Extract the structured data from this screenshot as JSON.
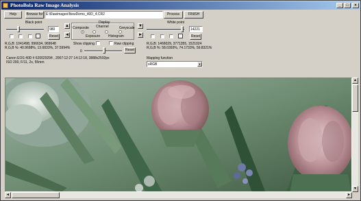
{
  "window": {
    "title": "PhotoBola Raw Image Analysis"
  },
  "toolbar": {
    "help": "Help",
    "browse": "Browse for",
    "file_path": "E:\\Rawimages\\NewDemo_40D_4.CR2",
    "process": "Process",
    "finish": "FINISH"
  },
  "black_point": {
    "title": "Black point",
    "value": "980",
    "reset": "Reset",
    "rgb": "R,G,B: 1041498, 996634, 969648",
    "rgb_pct": "R,G,B %: 40.9698%, 13.6833%, 37.5994%"
  },
  "white_point": {
    "title": "White point",
    "value": "14221",
    "reset": "Reset",
    "rgb": "R,G,B: 1466029, 3771355, 1521024",
    "rgb_pct": "R,G,B %: 58.0393%, 74.1733%, 59.8321%"
  },
  "display": {
    "title": "Display",
    "channel": "Channel",
    "composite": "Composite",
    "greyscale": "Greyscale",
    "exposure": "Exposure",
    "histogram": "Histogram",
    "show_clipping": "Show clipping",
    "raw_clipping": "Raw clipping",
    "zero": "0",
    "reset": "Reset"
  },
  "exif": {
    "line1": "Canon EOS 40D  # 620029294 ,  2007:12:27 14:12:18,   3888x2592px",
    "line2": "ISO 200,   F/11,   2s,   55mm"
  },
  "mapping": {
    "label": "Mapping function",
    "selected": "sRGB"
  },
  "icons": {
    "minimize": "_",
    "maximize": "□",
    "close": "×",
    "arrow_left": "◄",
    "arrow_right": "►",
    "arrow_up": "▲",
    "arrow_down": "▼",
    "dropdown": "▼"
  },
  "colors": {
    "title_bar": "#0a246a",
    "face": "#d4d0c8"
  }
}
